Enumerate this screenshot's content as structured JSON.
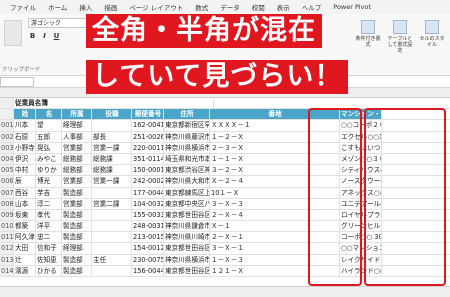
{
  "ribbon": {
    "tabs": [
      "ファイル",
      "ホーム",
      "挿入",
      "描画",
      "ページ レイアウト",
      "数式",
      "データ",
      "校閲",
      "表示",
      "ヘルプ",
      "Power Pivot"
    ],
    "font_name": "游ゴシック",
    "clipboard_label": "クリップボード",
    "right_buttons": [
      "条件付き書式",
      "テーブルとして書式設定",
      "セルのスタイル"
    ]
  },
  "namebox": "",
  "sheet_title": "従業員名簿",
  "columns": [
    "",
    "姓",
    "名",
    "所属",
    "役職",
    "郵便番号",
    "住所",
    "番地",
    "マンション・部屋番号"
  ],
  "rows": [
    [
      "001",
      "川本",
      "望",
      "経理部",
      "",
      "162-0041",
      "東京都新宿区早稲田鶴巻町",
      "ＸＸＸＸ－１",
      "○○コーポ２０５"
    ],
    [
      "002",
      "石原",
      "五郎",
      "人事部",
      "部長",
      "251-0026",
      "神奈川県藤沢市鵠沼東西町",
      "１－２－Ｘ",
      "エクセル○○103"
    ],
    [
      "003",
      "小野寺",
      "晃弘",
      "営業部",
      "営業一課",
      "220-0011",
      "神奈川県横浜市中央区自町",
      "２－３－Ｘ",
      "こすもはいつ１００"
    ],
    [
      "004",
      "伊沢",
      "みやこ",
      "総務部",
      "総務課",
      "351-0114",
      "埼玉県和光市本町",
      "１－１－Ｘ",
      "メゾン○○３０３"
    ],
    [
      "005",
      "中村",
      "ゆりか",
      "総務部",
      "総務課",
      "150-0001",
      "東京都渋谷区神宮前",
      "３－２－Ｘ",
      "シティハウス○○101"
    ],
    [
      "006",
      "辰",
      "博光",
      "営業部",
      "営業一課",
      "242-0002",
      "神奈川県大和市つきみ野",
      "Ｘ－２－４",
      "ノースタウー401"
    ],
    [
      "007",
      "西谷",
      "芋吉",
      "製造部",
      "",
      "177-0044",
      "東京都練馬区上石神井",
      "10１－Ｘ",
      "アネックス○○２０２"
    ],
    [
      "008",
      "山本",
      "淳二",
      "営業部",
      "営業二課",
      "104-0032",
      "東京都中央区八丁堀",
      "３－Ｘ－３",
      "ユニテアール○○603"
    ],
    [
      "009",
      "坂東",
      "孝代",
      "製造部",
      "",
      "155-0033",
      "東京都世田谷区代田",
      "２－Ｘ－４",
      "ロイヤルプラザ○○１０５"
    ],
    [
      "010",
      "都築",
      "洋平",
      "製造部",
      "",
      "248-0031",
      "神奈川県鎌倉市鎌倉山",
      "Ｘ－１",
      "グリーンヒルズ○○２０２"
    ],
    [
      "011",
      "阿久津",
      "忠二",
      "製造部",
      "",
      "213-0015",
      "神奈川県川崎市高津区梶ヶ谷",
      "２－Ｘ－１",
      "コーポ○○ 301"
    ],
    [
      "012",
      "大田",
      "信和子",
      "経理部",
      "",
      "154-0012",
      "東京都世田谷区駒沢",
      "３－Ｘ－１",
      "○○マンション Ａ棟 ２０５"
    ],
    [
      "013",
      "辻",
      "佐知恵",
      "製造部",
      "主任",
      "230-0075",
      "神奈川県横浜市鶴見区上の宮",
      "１－Ｘ－３",
      "レイクサイド○○２０５"
    ],
    [
      "014",
      "濱源",
      "ひかる",
      "製造部",
      "",
      "156-0044",
      "東京都世田谷区赤堤",
      "１２１－Ｘ",
      "ハイランド○○106"
    ]
  ],
  "headline": {
    "line1": "全角・半角が混在",
    "line2": "していて見づらい！"
  },
  "colors": {
    "header_fill": "#4aa5c8",
    "highlight": "#e0171f"
  }
}
